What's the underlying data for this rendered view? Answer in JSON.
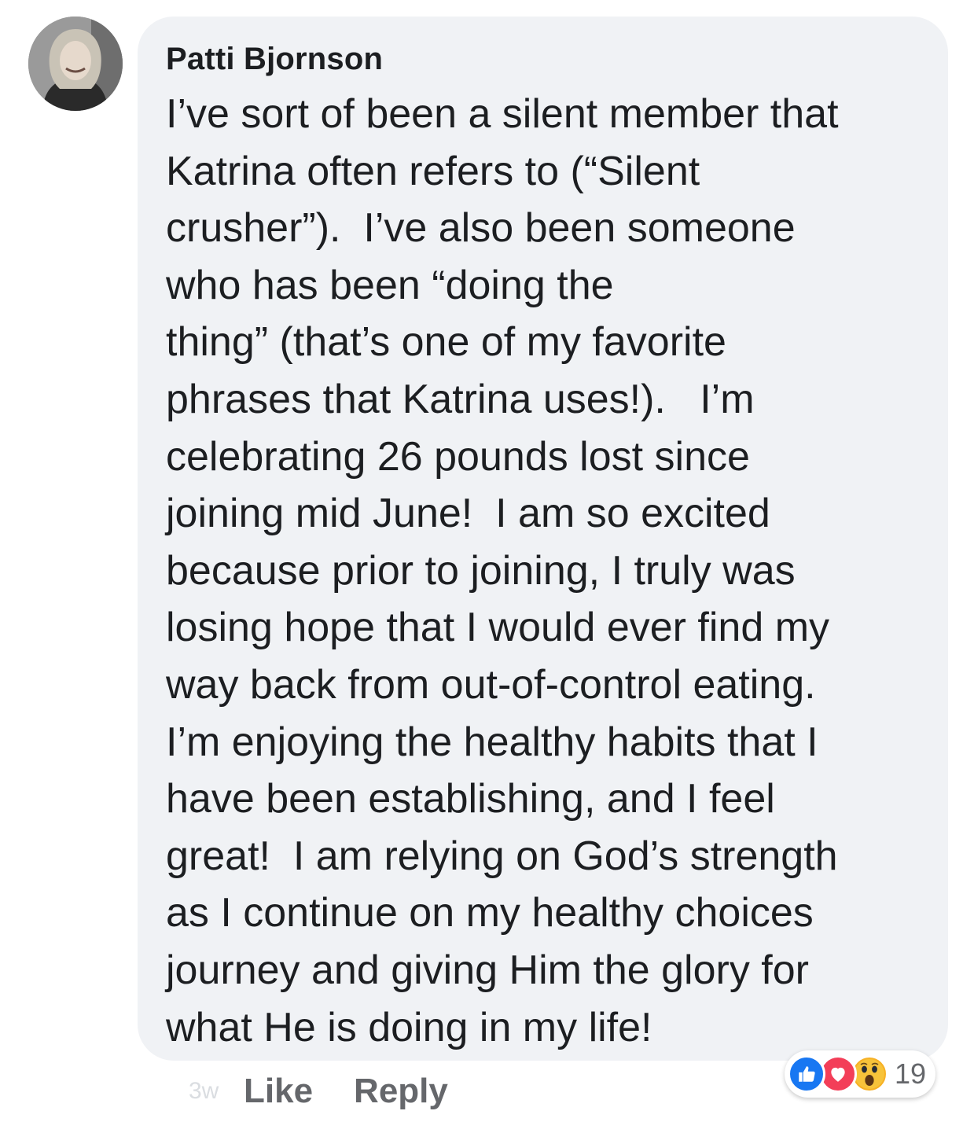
{
  "comment": {
    "author": "Patti Bjornson",
    "lines": [
      "I’ve sort of been a silent member that",
      "Katrina often refers to (“Silent",
      "crusher”).  I’ve also been someone",
      "who has been “doing the",
      "thing” (that’s one of my favorite",
      "phrases that Katrina uses!).   I’m",
      "celebrating 26 pounds lost since",
      "joining mid June!  I am so excited",
      "because prior to joining, I truly was",
      "losing hope that I would ever find my",
      "way back from out-of-control eating.",
      "I’m enjoying the healthy habits that I",
      "have been establishing, and I feel",
      "great!  I am relying on God’s strength",
      "as I continue on my healthy choices",
      "journey and giving Him the glory for",
      "what He is doing in my life!"
    ]
  },
  "actions": {
    "timestamp": "3w",
    "like_label": "Like",
    "reply_label": "Reply"
  },
  "reactions": {
    "icons": [
      "like-icon",
      "love-icon",
      "wow-icon"
    ],
    "count": "19",
    "colors": {
      "like": "#1877f2",
      "love": "#f33e58",
      "wow": "#f7b125"
    }
  },
  "theme": {
    "bubble_bg": "#f0f2f5",
    "text": "#1c1e21",
    "secondary_text": "#65676b"
  }
}
